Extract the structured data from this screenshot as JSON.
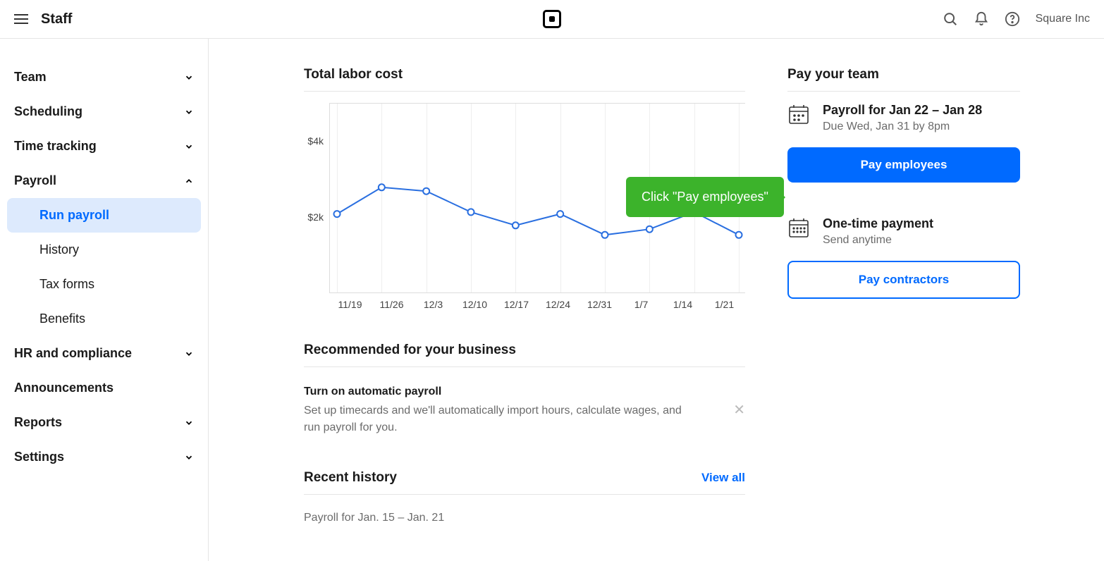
{
  "topbar": {
    "title": "Staff",
    "account": "Square Inc"
  },
  "sidebar": {
    "items": [
      {
        "label": "Team",
        "expanded": false
      },
      {
        "label": "Scheduling",
        "expanded": false
      },
      {
        "label": "Time tracking",
        "expanded": false
      },
      {
        "label": "Payroll",
        "expanded": true,
        "subitems": [
          {
            "label": "Run payroll",
            "active": true
          },
          {
            "label": "History"
          },
          {
            "label": "Tax forms"
          },
          {
            "label": "Benefits"
          }
        ]
      },
      {
        "label": "HR and compliance",
        "expanded": false
      },
      {
        "label": "Announcements",
        "has_chevron": false
      },
      {
        "label": "Reports",
        "expanded": false
      },
      {
        "label": "Settings",
        "expanded": false
      }
    ]
  },
  "main": {
    "total_labor_title": "Total labor cost",
    "recommended_title": "Recommended for your business",
    "recommended_item": {
      "title": "Turn on automatic payroll",
      "desc": "Set up timecards and we'll automatically import hours, calculate wages, and run payroll for you."
    },
    "recent_history_title": "Recent history",
    "view_all_label": "View all",
    "recent_history_row": "Payroll for Jan. 15 – Jan. 21"
  },
  "right": {
    "pay_team_title": "Pay your team",
    "payroll_title": "Payroll for Jan 22 – Jan 28",
    "payroll_due": "Due Wed, Jan 31 by 8pm",
    "pay_employees_btn": "Pay employees",
    "one_time_title": "One-time payment",
    "one_time_sub": "Send anytime",
    "pay_contractors_btn": "Pay contractors"
  },
  "tooltip_text": "Click \"Pay employees\"",
  "chart_data": {
    "type": "line",
    "title": "Total labor cost",
    "xlabel": "",
    "ylabel": "",
    "ylim": [
      0,
      5000
    ],
    "y_ticks": [
      2000,
      4000
    ],
    "y_tick_labels": [
      "$2k",
      "$4k"
    ],
    "categories": [
      "11/19",
      "11/26",
      "12/3",
      "12/10",
      "12/17",
      "12/24",
      "12/31",
      "1/7",
      "1/14",
      "1/21"
    ],
    "values": [
      2100,
      2800,
      2700,
      2150,
      1800,
      2100,
      1550,
      1700,
      2150,
      1550
    ]
  }
}
